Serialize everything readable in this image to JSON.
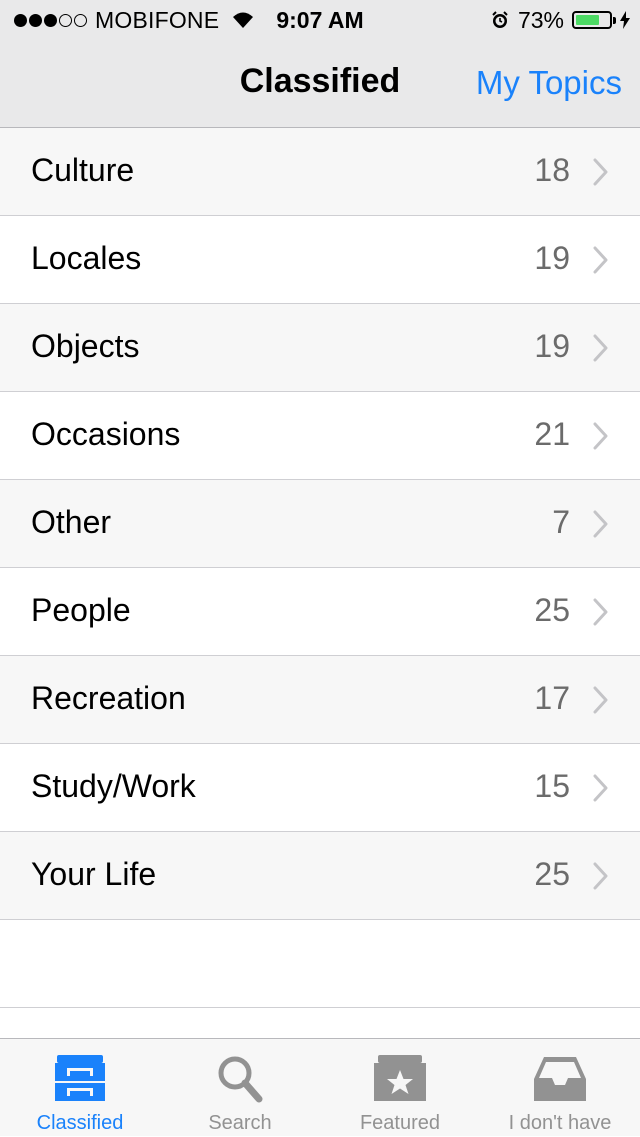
{
  "status_bar": {
    "carrier": "MOBIFONE",
    "signal_bars_filled": 3,
    "signal_bars_total": 5,
    "time": "9:07 AM",
    "battery_percent_label": "73%",
    "battery_level": 0.73,
    "battery_color": "#4cd964"
  },
  "nav": {
    "title": "Classified",
    "right_button": "My Topics",
    "accent_color": "#1a82fb"
  },
  "categories": [
    {
      "label": "Culture",
      "count": "18"
    },
    {
      "label": "Locales",
      "count": "19"
    },
    {
      "label": "Objects",
      "count": "19"
    },
    {
      "label": "Occasions",
      "count": "21"
    },
    {
      "label": "Other",
      "count": "7"
    },
    {
      "label": "People",
      "count": "25"
    },
    {
      "label": "Recreation",
      "count": "17"
    },
    {
      "label": "Study/Work",
      "count": "15"
    },
    {
      "label": "Your Life",
      "count": "25"
    }
  ],
  "tabs": [
    {
      "label": "Classified",
      "icon": "cabinet-icon",
      "active": true
    },
    {
      "label": "Search",
      "icon": "search-icon",
      "active": false
    },
    {
      "label": "Featured",
      "icon": "featured-star-box-icon",
      "active": false
    },
    {
      "label": "I don't have",
      "icon": "inbox-tray-icon",
      "active": false
    }
  ]
}
